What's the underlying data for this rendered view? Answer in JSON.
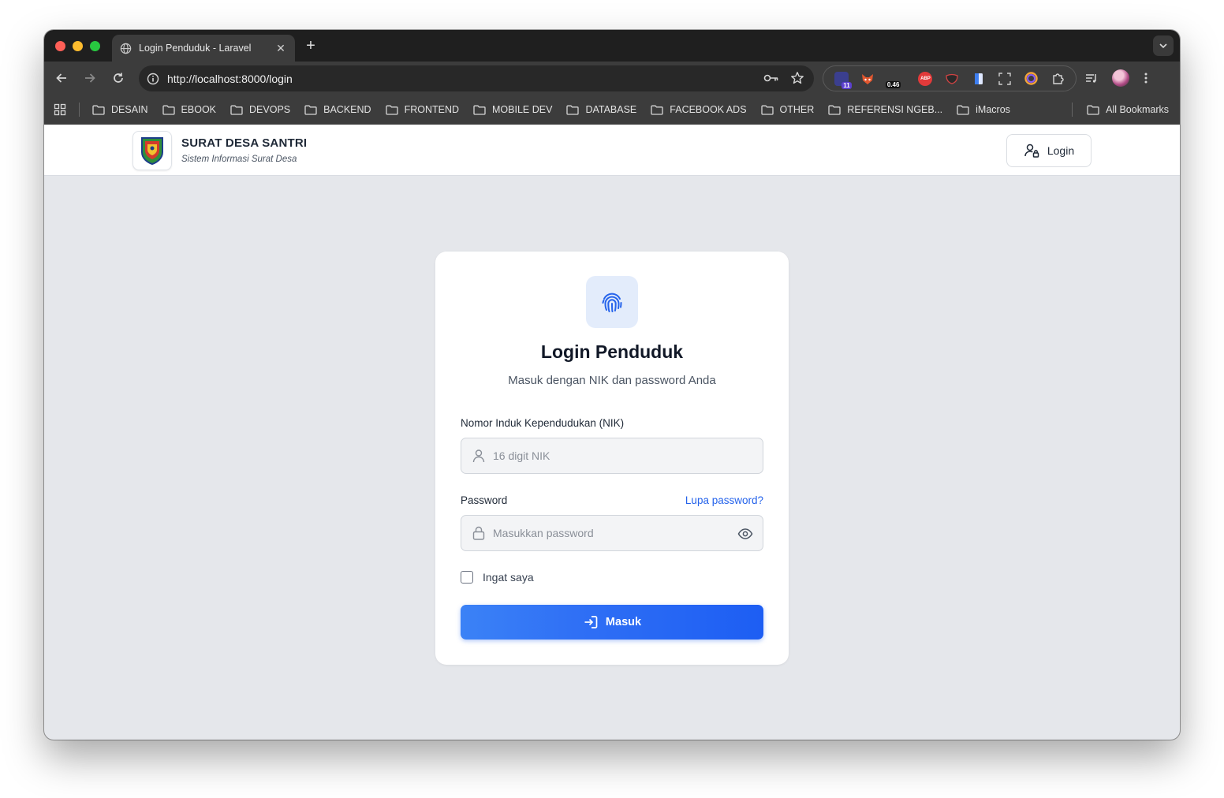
{
  "browser": {
    "tab_title": "Login Penduduk - Laravel",
    "url_scheme": "http://",
    "url_host": "localhost:8000/login",
    "extensions": [
      {
        "name": "ext-badge-icon",
        "badge": "11"
      },
      {
        "name": "fox-extension-icon",
        "badge": ""
      },
      {
        "name": "counter-extension-icon",
        "badge": "0.46"
      },
      {
        "name": "adblock-icon",
        "badge": "ABP"
      },
      {
        "name": "mask-extension-icon",
        "badge": ""
      },
      {
        "name": "file-extension-icon",
        "badge": ""
      },
      {
        "name": "screenshot-extension-icon",
        "badge": ""
      },
      {
        "name": "color-extension-icon",
        "badge": ""
      },
      {
        "name": "puzzle-icon",
        "badge": ""
      }
    ]
  },
  "bookmarks": {
    "items": [
      "DESAIN",
      "EBOOK",
      "DEVOPS",
      "BACKEND",
      "FRONTEND",
      "MOBILE DEV",
      "DATABASE",
      "FACEBOOK ADS",
      "OTHER",
      "REFERENSI NGEB...",
      "iMacros"
    ],
    "all": "All Bookmarks"
  },
  "header": {
    "brand_title": "SURAT DESA SANTRI",
    "brand_subtitle": "Sistem Informasi Surat Desa",
    "login_label": "Login"
  },
  "card": {
    "title": "Login Penduduk",
    "subtitle": "Masuk dengan NIK dan password Anda",
    "nik_label": "Nomor Induk Kependudukan (NIK)",
    "nik_placeholder": "16 digit NIK",
    "password_label": "Password",
    "forgot_label": "Lupa password?",
    "password_placeholder": "Masukkan password",
    "remember_label": "Ingat saya",
    "submit_label": "Masuk"
  },
  "colors": {
    "primary": "#2563eb",
    "icon_bg": "#e3ecfb",
    "page_bg": "#e5e7eb"
  }
}
